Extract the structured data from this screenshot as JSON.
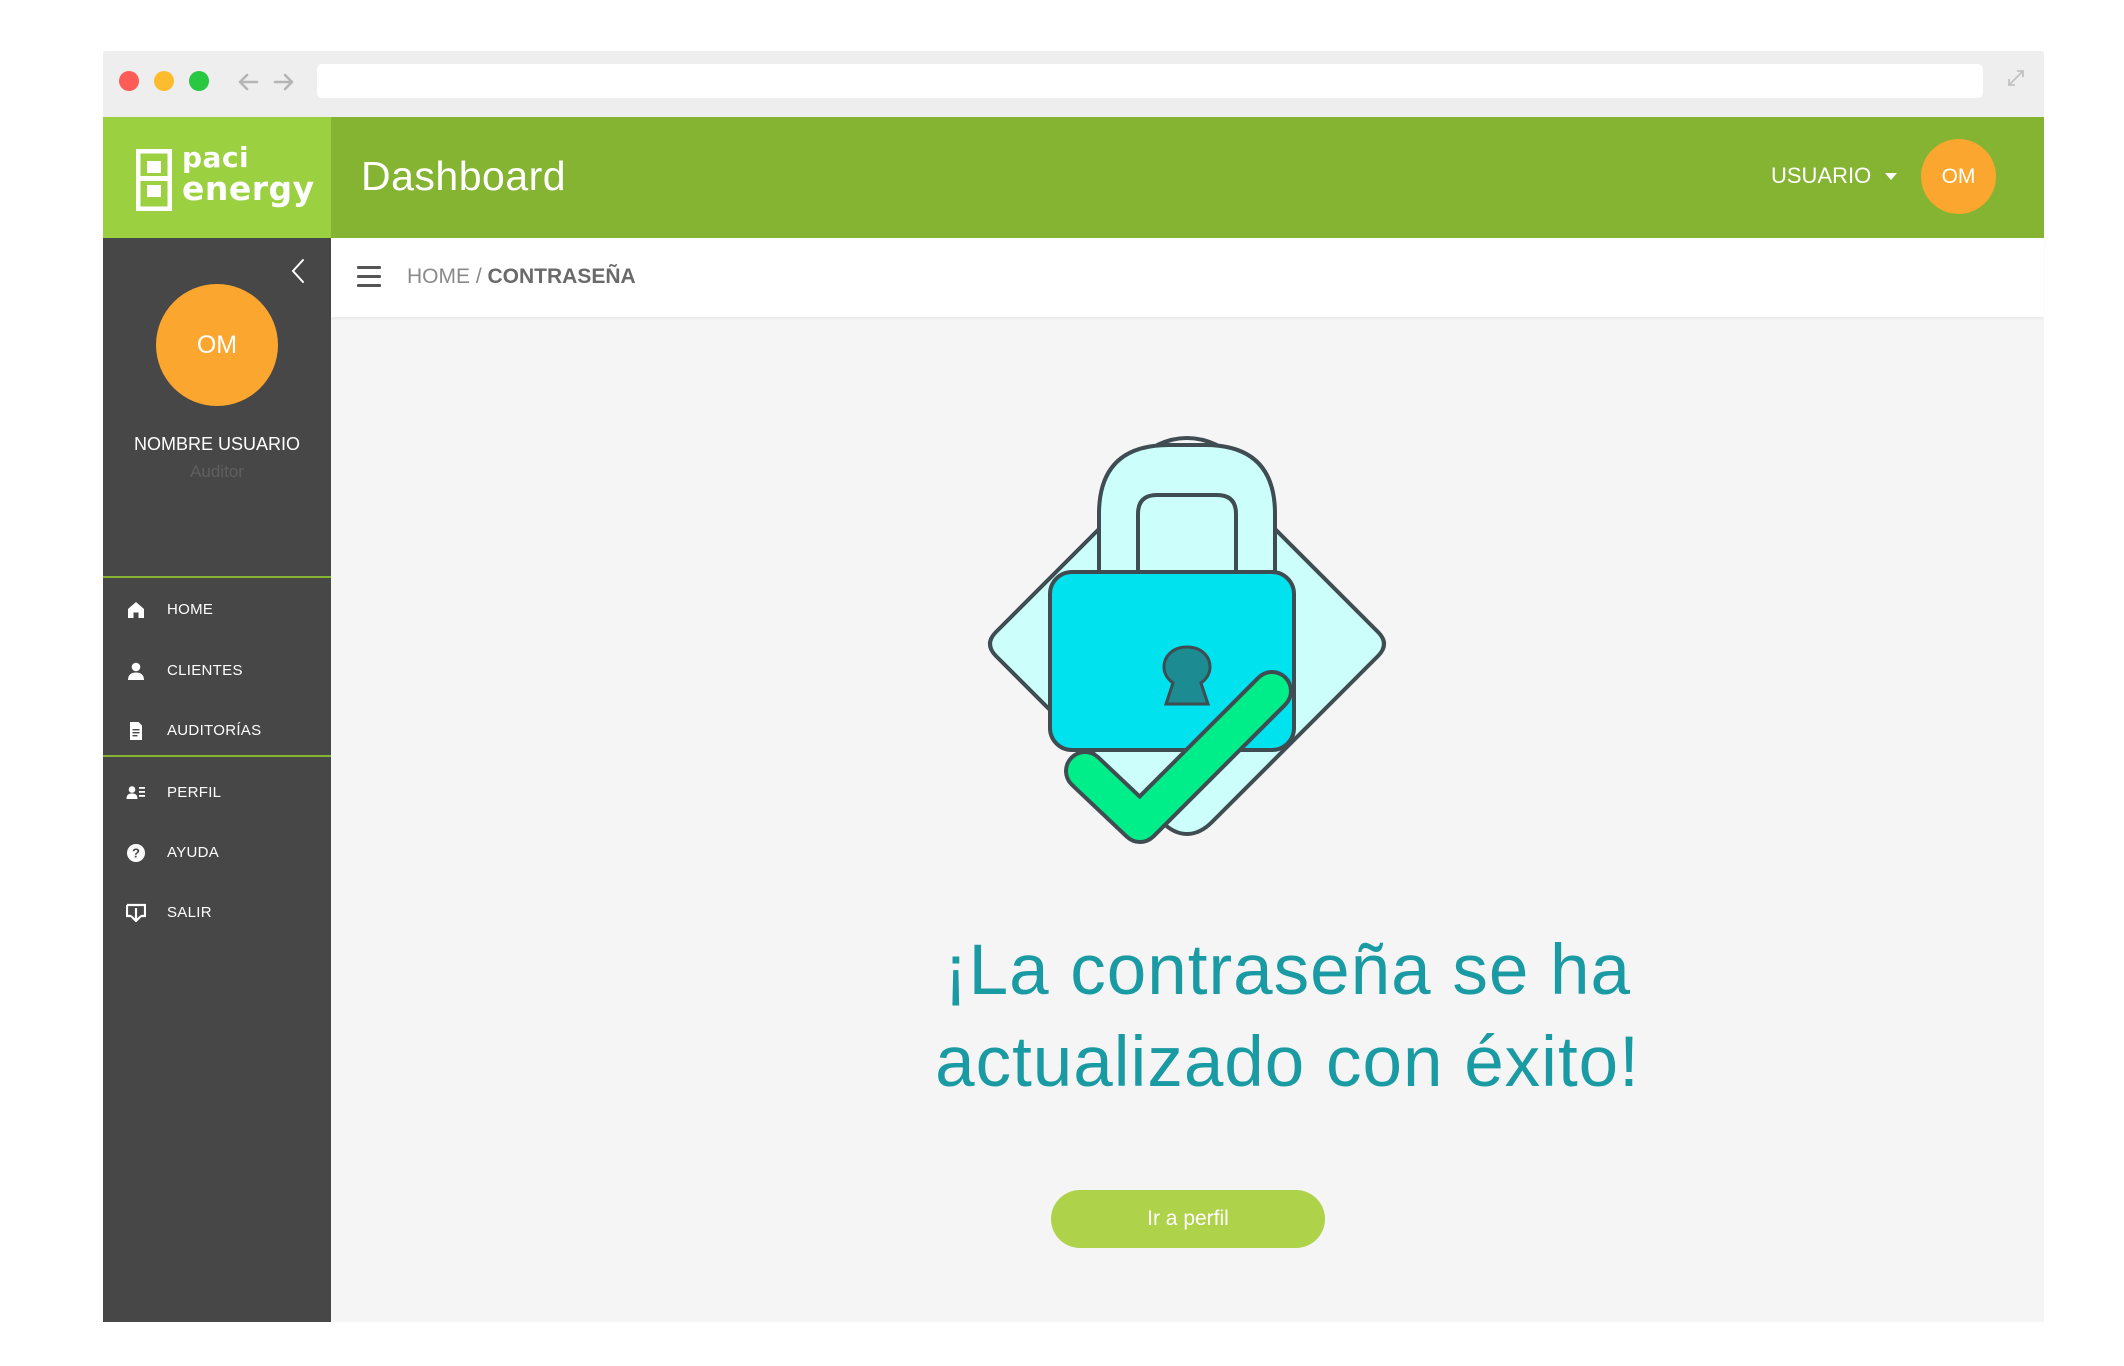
{
  "app": {
    "logo_line1": "paci",
    "logo_line2": "energy",
    "page_title": "Dashboard"
  },
  "header": {
    "user_menu_label": "USUARIO",
    "avatar_initials": "OM"
  },
  "sidebar": {
    "avatar_initials": "OM",
    "user_name": "NOMBRE USUARIO",
    "user_role": "Auditor",
    "items": [
      {
        "label": "HOME",
        "icon": "home-icon"
      },
      {
        "label": "CLIENTES",
        "icon": "user-icon"
      },
      {
        "label": "AUDITORÍAS",
        "icon": "document-icon"
      },
      {
        "label": "PERFIL",
        "icon": "profile-card-icon"
      },
      {
        "label": "AYUDA",
        "icon": "help-icon"
      },
      {
        "label": "SALIR",
        "icon": "logout-icon"
      }
    ]
  },
  "breadcrumb": {
    "home": "HOME",
    "separator": " / ",
    "current": "CONTRASEÑA"
  },
  "main": {
    "message_line1": "¡La contraseña se ha",
    "message_line2": "actualizado con éxito!",
    "button_label": "Ir a perfil",
    "illustration": "padlock-check-icon"
  },
  "colors": {
    "header_green": "#84b431",
    "logo_green": "#9bd041",
    "sidebar_dark": "#474747",
    "avatar_orange": "#fba62e",
    "message_teal": "#1a9aa3",
    "button_green": "#aed24a",
    "lock_cyan": "#00e2ee",
    "check_green": "#00ee8a"
  }
}
